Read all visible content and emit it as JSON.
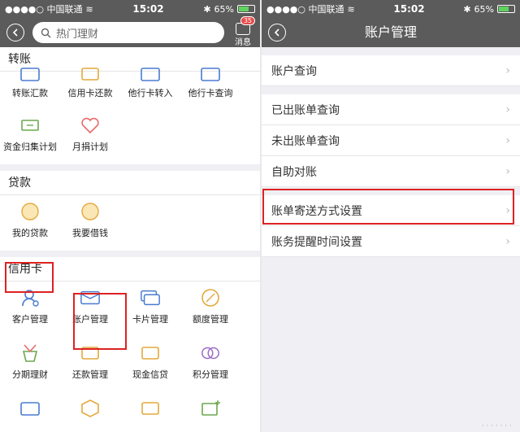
{
  "status": {
    "carrier": "●●●●○ 中国联通",
    "time": "15:02",
    "battery": "65%",
    "battery_level": 0.65
  },
  "left": {
    "search_placeholder": "热门理财",
    "message_label": "消息",
    "message_badge": "35",
    "sections": [
      {
        "title": "转账",
        "items": [
          "转账汇款",
          "信用卡还款",
          "他行卡转入",
          "他行卡查询",
          "资金归集计划",
          "月捐计划"
        ]
      },
      {
        "title": "贷款",
        "items": [
          "我的贷款",
          "我要借钱"
        ]
      },
      {
        "title": "信用卡",
        "items": [
          "客户管理",
          "账户管理",
          "卡片管理",
          "额度管理",
          "分期理财",
          "还款管理",
          "现金信贷",
          "积分管理",
          "",
          "",
          "",
          ""
        ]
      }
    ]
  },
  "right": {
    "title": "账户管理",
    "groups": [
      [
        "账户查询"
      ],
      [
        "已出账单查询",
        "未出账单查询",
        "自助对账"
      ],
      [
        "账单寄送方式设置",
        "账务提醒时间设置"
      ]
    ]
  },
  "colors": {
    "navbar": "#5b5b5b",
    "highlight": "#d22222",
    "icon_blue": "#4a7bd0",
    "icon_gold": "#e3a93c",
    "icon_green": "#6aa84f",
    "icon_red": "#e86a6a",
    "icon_purple": "#9b6bc8"
  }
}
